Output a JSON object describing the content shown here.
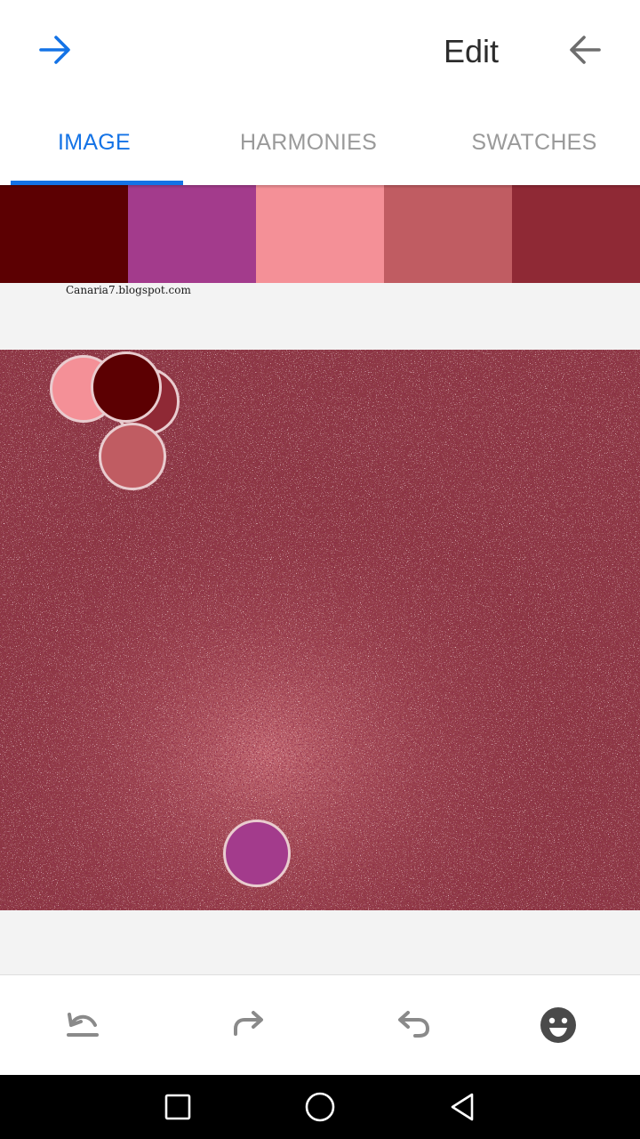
{
  "header": {
    "title": "Edit",
    "forward_icon": "arrow-right-icon",
    "back_icon": "arrow-left-icon"
  },
  "tabs": [
    {
      "label": "IMAGE",
      "active": true
    },
    {
      "label": "HARMONIES",
      "active": false
    },
    {
      "label": "SWATCHES",
      "active": false
    }
  ],
  "swatches": [
    "#5c0002",
    "#a33b8c",
    "#f49097",
    "#c05c62",
    "#8f2935"
  ],
  "watermark": "Canaria7.blogspot.com",
  "toolbar": {
    "icons": [
      "undo-all-icon",
      "redo-icon",
      "undo-icon",
      "smiley-icon"
    ]
  },
  "navbar": {
    "icons": [
      "recent-apps-icon",
      "home-icon",
      "back-triangle-icon"
    ]
  },
  "colors": {
    "accent": "#1473e6",
    "tab_inactive": "#9a9a9a"
  }
}
